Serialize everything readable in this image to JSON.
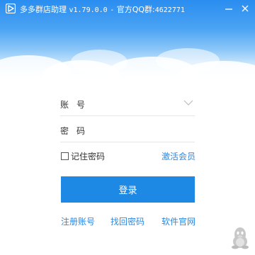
{
  "titlebar": {
    "app_name": "多多群店助理",
    "version": "v1.79.0.0",
    "separator": "-",
    "qq_group_label": "官方QQ群:",
    "qq_group_number": "4622771"
  },
  "form": {
    "account_label": "账号",
    "account_value": "",
    "password_label": "密码",
    "password_value": "",
    "remember_label": "记住密码",
    "remember_checked": false,
    "activate_link": "激活会员",
    "login_button": "登录"
  },
  "footer_links": {
    "register": "注册账号",
    "recover": "找回密码",
    "website": "软件官网"
  },
  "colors": {
    "accent": "#1e88e5",
    "link": "#2b89e5",
    "header_top": "#2a8df0"
  },
  "icons": [
    "app-logo-icon",
    "minimize-icon",
    "close-icon",
    "chevron-down-icon",
    "qq-penguin-icon"
  ]
}
